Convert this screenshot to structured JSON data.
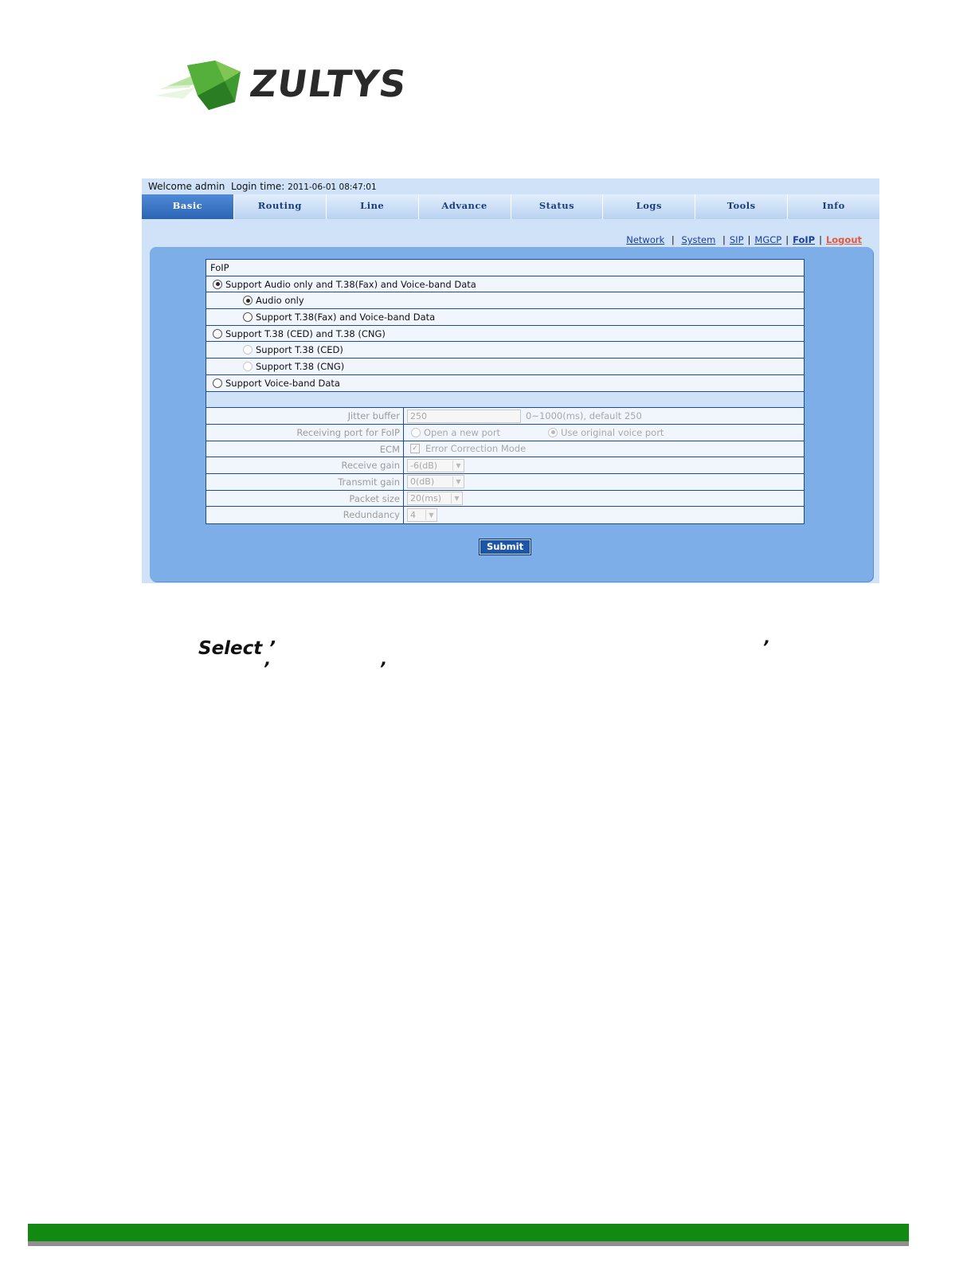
{
  "logo": {
    "text": "ZULTYS"
  },
  "topbar": {
    "welcome": "Welcome admin",
    "login_label": "Login time: ",
    "login_time": "2011-06-01 08:47:01"
  },
  "tabs": [
    {
      "label": "Basic",
      "active": true
    },
    {
      "label": "Routing"
    },
    {
      "label": "Line"
    },
    {
      "label": "Advance"
    },
    {
      "label": "Status"
    },
    {
      "label": "Logs"
    },
    {
      "label": "Tools"
    },
    {
      "label": "Info"
    }
  ],
  "sublinks": {
    "network": "Network",
    "system": "System",
    "sip": "SIP",
    "mgcp": "MGCP",
    "foip": "FoIP",
    "logout": "Logout",
    "separator": "|"
  },
  "foip": {
    "header": "FoIP",
    "options": {
      "audio_t38_voiceband": "Support Audio only and T.38(Fax) and Voice-band Data",
      "audio_only": "Audio only",
      "t38_voiceband": "Support T.38(Fax) and Voice-band Data",
      "t38_ced_cng": "Support T.38 (CED) and T.38 (CNG)",
      "t38_ced": "Support T.38 (CED)",
      "t38_cng": "Support T.38 (CNG)",
      "voiceband": "Support Voice-band Data"
    },
    "fields": {
      "jitter_label": "Jitter buffer",
      "jitter_value": "250",
      "jitter_hint": "0~1000(ms), default 250",
      "port_label": "Receiving port for FoIP",
      "port_open_new": "Open a new port",
      "port_use_original": "Use original voice port",
      "ecm_label": "ECM",
      "ecm_option": "Error Correction Mode",
      "receive_gain_label": "Receive gain",
      "receive_gain_value": "-6(dB)",
      "transmit_gain_label": "Transmit gain",
      "transmit_gain_value": "0(dB)",
      "packet_size_label": "Packet size",
      "packet_size_value": "20(ms)",
      "redundancy_label": "Redundancy",
      "redundancy_value": "4"
    },
    "submit": "Submit"
  },
  "caption": {
    "text": "Select ’"
  },
  "colors": {
    "footer_green": "#128a12",
    "panel_blue": "#7daee7",
    "tab_active": "#2b64b3"
  }
}
